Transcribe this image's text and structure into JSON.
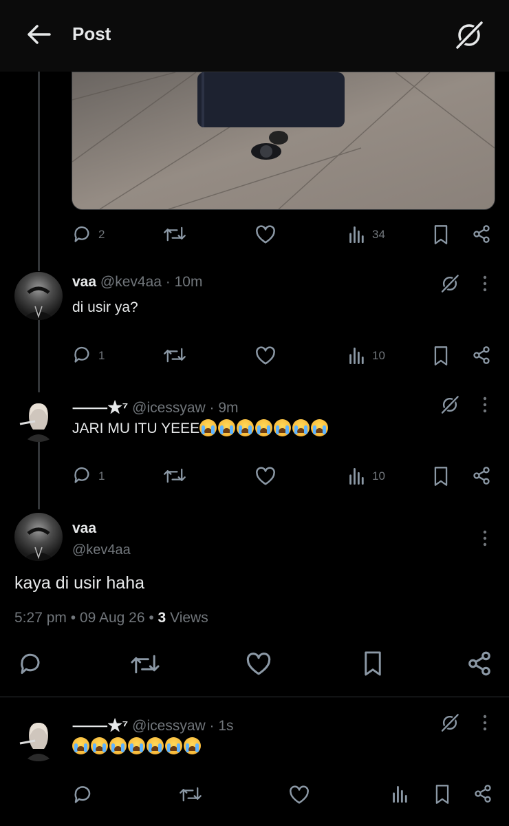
{
  "header": {
    "title": "Post"
  },
  "parent_post": {
    "stats": {
      "replies": "2",
      "views": "34"
    }
  },
  "replies_above": [
    {
      "name": "vaa",
      "handle": "@kev4aa",
      "time": "10m",
      "text": "di usir ya?",
      "replies": "1",
      "views": "10"
    },
    {
      "name": "⸻★⁷",
      "handle": "@icessyaw",
      "time": "9m",
      "text": "JARI MU ITU YEEE",
      "emoji_count": 7,
      "emoji": "loudly-crying-face",
      "replies": "1",
      "views": "10"
    }
  ],
  "focused_post": {
    "name": "vaa",
    "handle": "@kev4aa",
    "text": "kaya di usir haha",
    "time": "5:27 pm",
    "date": "09 Aug 26",
    "views_count": "3",
    "views_label": "Views"
  },
  "reply_below": {
    "name": "⸻★⁷",
    "handle": "@icessyaw",
    "time": "1s",
    "emoji_count": 7,
    "emoji": "loudly-crying-face"
  },
  "colors": {
    "background": "#000000",
    "text": "#e7e9ea",
    "muted": "#71767b",
    "divider": "#2f3336"
  }
}
